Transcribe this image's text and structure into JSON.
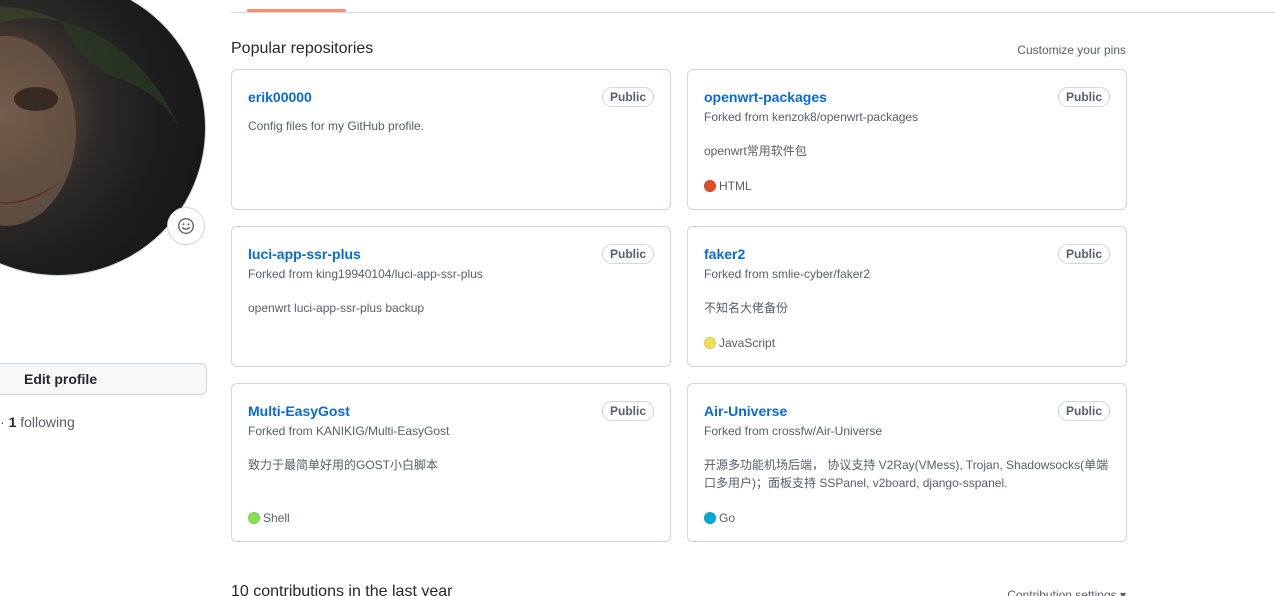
{
  "sidebar": {
    "edit_profile_label": "Edit profile",
    "follow_prefix": "· ",
    "following_count": "1",
    "following_label": " following"
  },
  "section": {
    "title": "Popular repositories",
    "customize_label": "Customize your pins"
  },
  "repos": [
    {
      "name": "erik00000",
      "visibility": "Public",
      "forked_from": "",
      "description": "Config files for my GitHub profile.",
      "language": "",
      "lang_color": ""
    },
    {
      "name": "openwrt-packages",
      "visibility": "Public",
      "forked_from": "Forked from kenzok8/openwrt-packages",
      "description": "openwrt常用软件包",
      "language": "HTML",
      "lang_color": "#e34c26"
    },
    {
      "name": "luci-app-ssr-plus",
      "visibility": "Public",
      "forked_from": "Forked from king19940104/luci-app-ssr-plus",
      "description": "openwrt luci-app-ssr-plus backup",
      "language": "",
      "lang_color": ""
    },
    {
      "name": "faker2",
      "visibility": "Public",
      "forked_from": "Forked from smlie-cyber/faker2",
      "description": "不知名大佬备份",
      "language": "JavaScript",
      "lang_color": "#f1e05a"
    },
    {
      "name": "Multi-EasyGost",
      "visibility": "Public",
      "forked_from": "Forked from KANIKIG/Multi-EasyGost",
      "description": "致力于最简单好用的GOST小白脚本",
      "language": "Shell",
      "lang_color": "#89e051"
    },
    {
      "name": "Air-Universe",
      "visibility": "Public",
      "forked_from": "Forked from crossfw/Air-Universe",
      "description": "开源多功能机场后端， 协议支持 V2Ray(VMess), Trojan, Shadowsocks(单端口多用户)；面板支持 SSPanel, v2board, django-sspanel.",
      "language": "Go",
      "lang_color": "#00add8"
    }
  ],
  "contributions": {
    "title": "10 contributions in the last year",
    "settings_label": "Contribution settings ▾"
  },
  "icons": {
    "status": "smiley-icon"
  }
}
